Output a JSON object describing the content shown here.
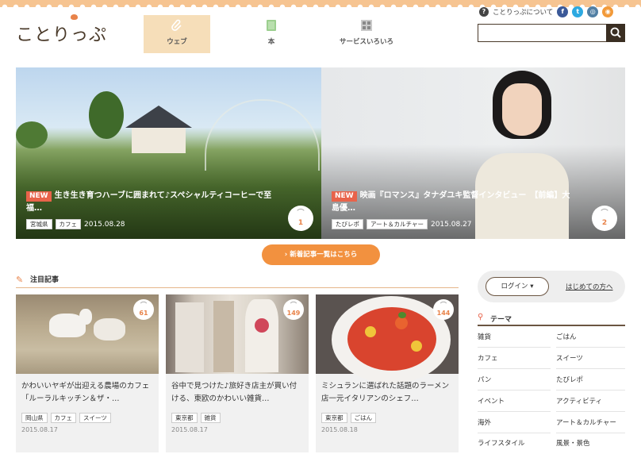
{
  "brand": {
    "logo_text": "ことりっぷ"
  },
  "nav": {
    "tabs": [
      {
        "label": "ウェブ",
        "icon": "paperclip-icon",
        "active": true
      },
      {
        "label": "本",
        "icon": "book-icon",
        "active": false
      },
      {
        "label": "サービスいろいろ",
        "icon": "grid-icon",
        "active": false
      }
    ]
  },
  "top_right": {
    "about_label": "ことりっぷについて",
    "social": [
      {
        "name": "facebook-icon",
        "glyph": "f",
        "color": "#3b5998"
      },
      {
        "name": "twitter-icon",
        "glyph": "t",
        "color": "#2da9e1"
      },
      {
        "name": "instagram-icon",
        "glyph": "◎",
        "color": "#517fa4"
      },
      {
        "name": "rss-icon",
        "glyph": "◉",
        "color": "#f29a3a"
      }
    ]
  },
  "search": {
    "value": "",
    "placeholder": ""
  },
  "hero": [
    {
      "new_label": "NEW",
      "title": "生き生き育つハーブに囲まれて♪スペシャルティコーヒーで至福…",
      "tags": [
        "宮城県",
        "カフェ"
      ],
      "date": "2015.08.28",
      "clip_count": "1"
    },
    {
      "new_label": "NEW",
      "title": "映画『ロマンス』タナダユキ監督インタビュー　【前編】大島優…",
      "tags": [
        "たびレポ",
        "アート＆カルチャー"
      ],
      "date": "2015.08.27",
      "clip_count": "2"
    }
  ],
  "more_button": {
    "label": "新着記事一覧はこちら"
  },
  "featured": {
    "heading": "注目記事",
    "cards": [
      {
        "title": "かわいいヤギが出迎える農場のカフェ「ルーラルキッチン＆ザ・…",
        "tags": [
          "岡山県",
          "カフェ",
          "スイーツ"
        ],
        "date": "2015.08.17",
        "clip_count": "61"
      },
      {
        "title": "谷中で見つけた♪旅好き店主が買い付ける、東欧のかわいい雑貨…",
        "tags": [
          "東京都",
          "雑貨"
        ],
        "date": "2015.08.17",
        "clip_count": "149"
      },
      {
        "title": "ミシュランに選ばれた話題のラーメン店一元イタリアンのシェフ…",
        "tags": [
          "東京都",
          "ごはん"
        ],
        "date": "2015.08.18",
        "clip_count": "144"
      }
    ]
  },
  "sidebar": {
    "login_label": "ログイン ▾",
    "first_time_label": "はじめての方へ",
    "theme_heading": "テーマ",
    "themes": [
      "雑貨",
      "ごはん",
      "カフェ",
      "スイーツ",
      "パン",
      "たびレポ",
      "イベント",
      "アクティビティ",
      "海外",
      "アート＆カルチャー",
      "ライフスタイル",
      "風景・景色"
    ]
  },
  "colors": {
    "accent": "#f2913f",
    "new_badge": "#e8634a",
    "nav_active": "#f6deb9",
    "dark_brown": "#3a2e22"
  }
}
